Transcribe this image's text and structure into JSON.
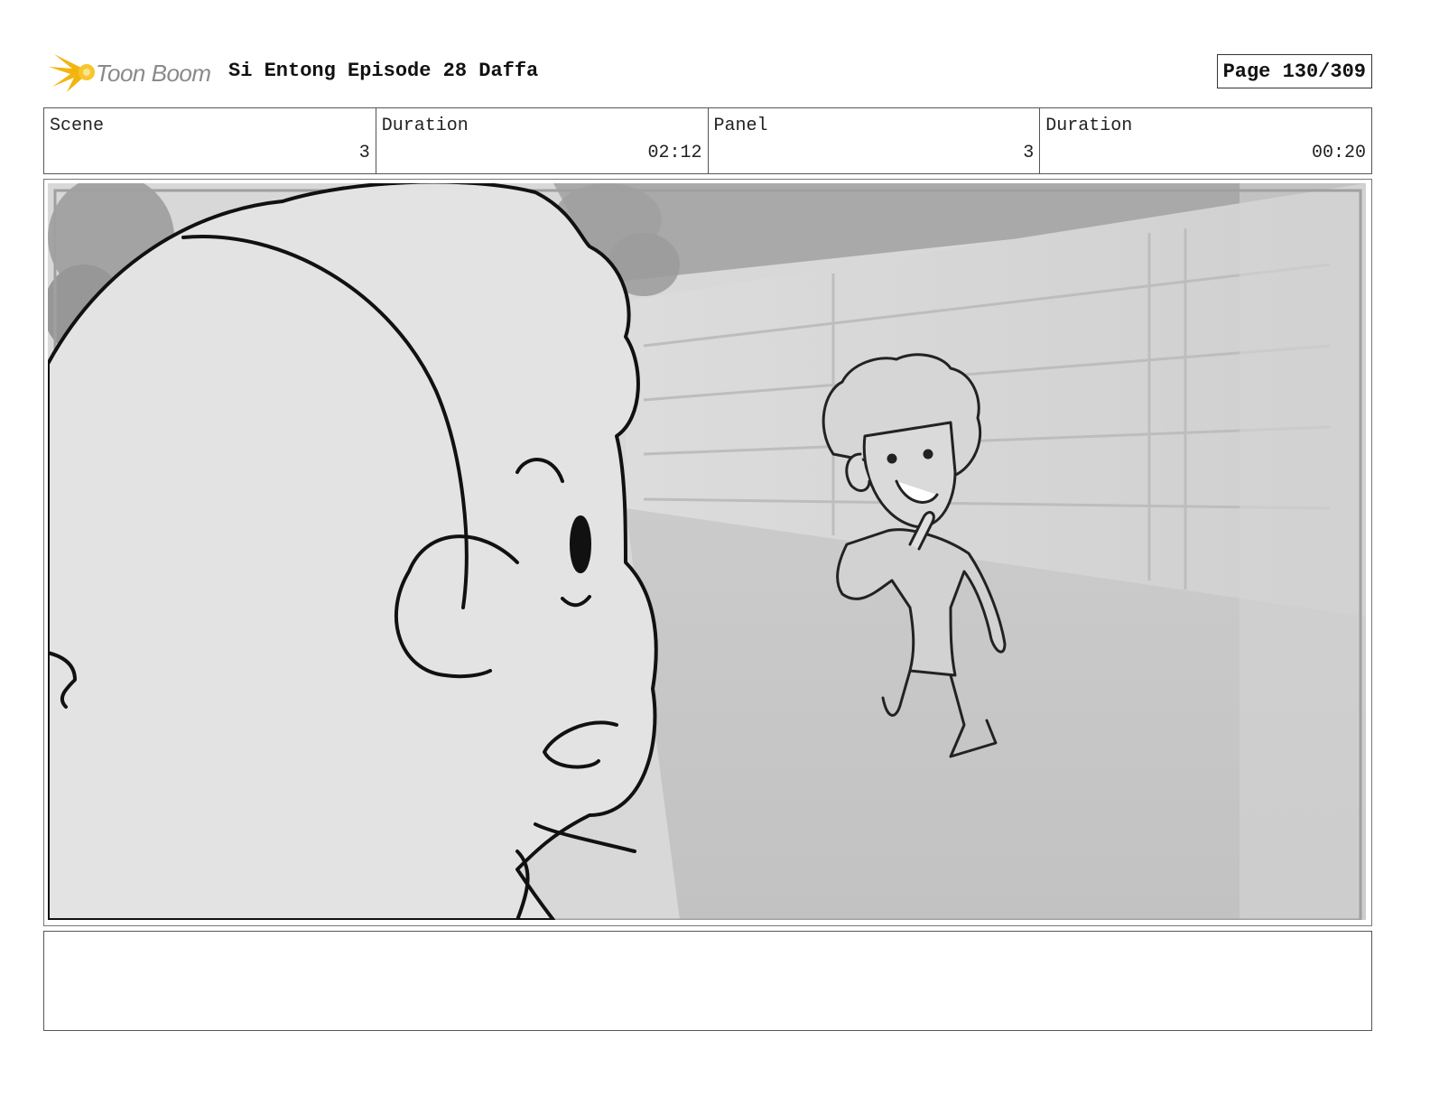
{
  "header": {
    "logo_text": "Toon Boom",
    "title": "Si Entong Episode 28 Daffa",
    "page": "Page 130/309"
  },
  "info": [
    {
      "label": "Scene",
      "value": "3"
    },
    {
      "label": "Duration",
      "value": "02:12"
    },
    {
      "label": "Panel",
      "value": "3"
    },
    {
      "label": "Duration",
      "value": "00:20"
    }
  ],
  "notes": {
    "text": ""
  },
  "colors": {
    "logo_accent": "#f2b50f",
    "logo_text": "#8a8a8a"
  }
}
